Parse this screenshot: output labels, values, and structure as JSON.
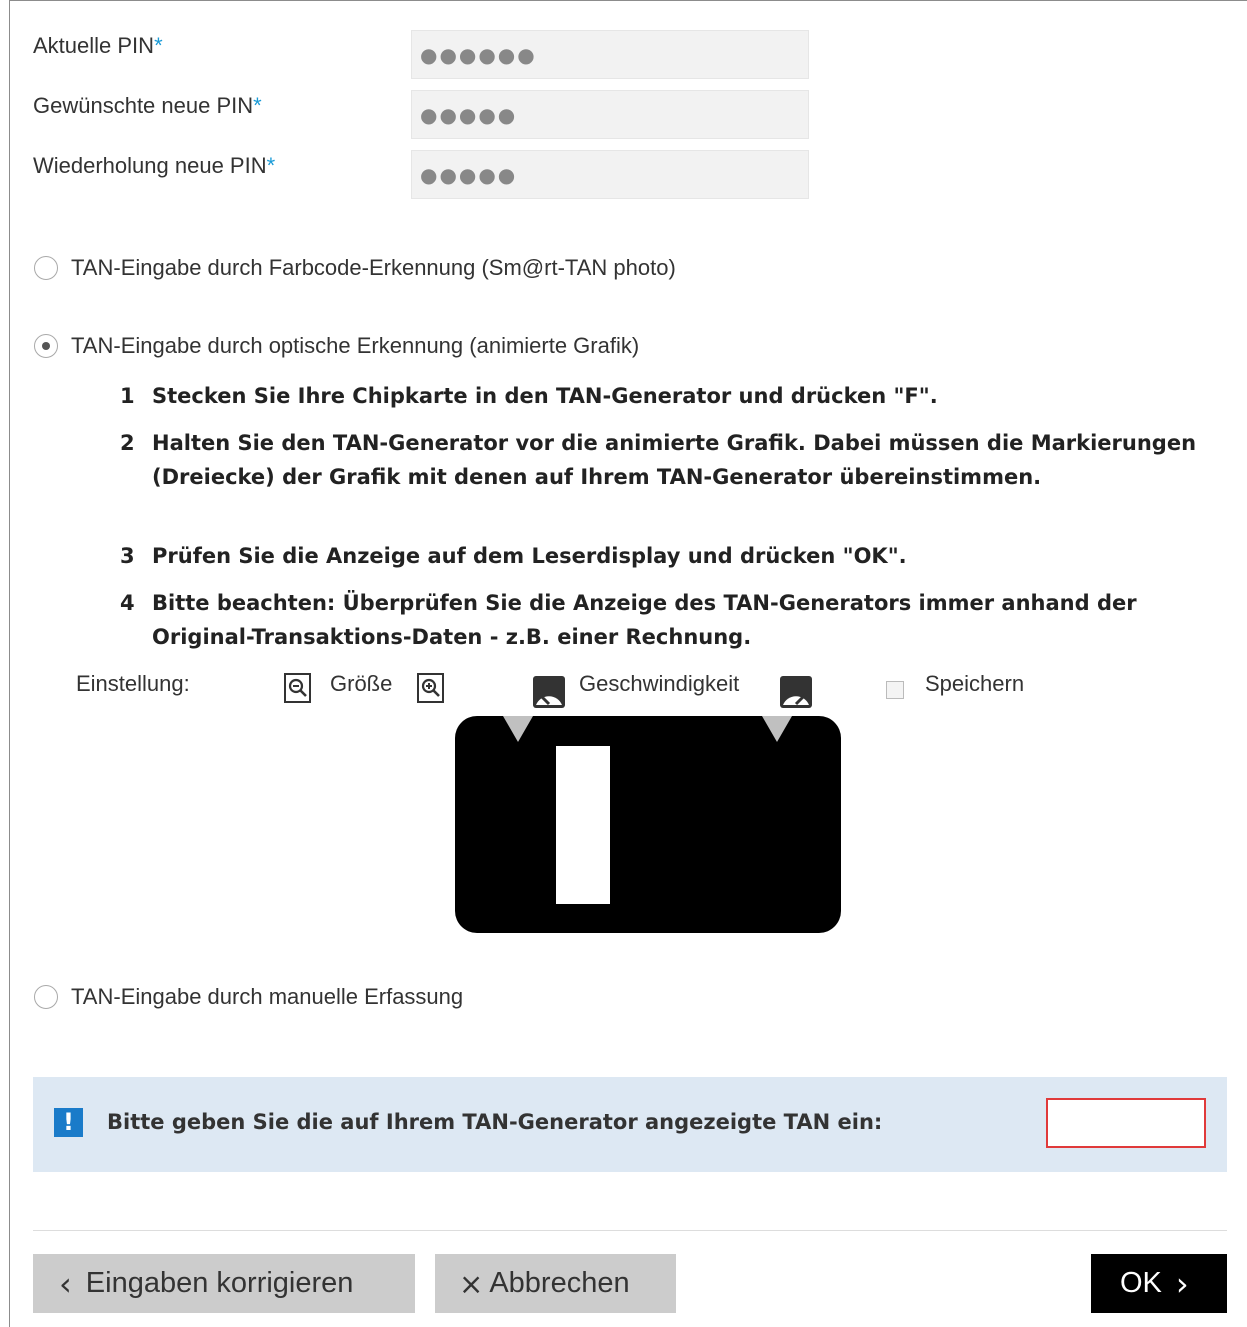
{
  "pin_fields": [
    {
      "label": "Aktuelle PIN",
      "required_mark": "*",
      "value": "●●●●●●"
    },
    {
      "label": "Gewünschte neue PIN",
      "required_mark": "*",
      "value": "●●●●●"
    },
    {
      "label": "Wiederholung neue PIN",
      "required_mark": "*",
      "value": "●●●●●"
    }
  ],
  "tan_methods": [
    {
      "label": "TAN-Eingabe durch Farbcode-Erkennung (Sm@rt-TAN photo)",
      "selected": false
    },
    {
      "label": "TAN-Eingabe durch optische Erkennung (animierte Grafik)",
      "selected": true
    },
    {
      "label": "TAN-Eingabe durch manuelle Erfassung",
      "selected": false
    }
  ],
  "steps": [
    {
      "num": "1",
      "text": "Stecken Sie Ihre Chipkarte in den TAN-Generator und drücken \"F\"."
    },
    {
      "num": "2",
      "text": "Halten Sie den TAN-Generator vor die animierte Grafik. Dabei müssen die Markierungen (Dreiecke) der Grafik mit denen auf Ihrem TAN-Generator übereinstimmen."
    },
    {
      "num": "3",
      "text": "Prüfen Sie die Anzeige auf dem Leserdisplay und drücken \"OK\"."
    },
    {
      "num": "4",
      "text": "Bitte beachten: Überprüfen Sie die Anzeige des TAN-Generators immer anhand der Original-Transaktions-Daten - z.B. einer Rechnung."
    }
  ],
  "settings": {
    "label": "Einstellung:",
    "size_label": "Größe",
    "speed_label": "Geschwindigkeit",
    "save_label": "Speichern",
    "save_checked": false
  },
  "notice": {
    "icon": "!",
    "message": "Bitte geben Sie die auf Ihrem TAN-Generator angezeigte TAN ein:",
    "tan_value": ""
  },
  "buttons": {
    "correct": "Eingaben korrigieren",
    "correct_icon": "‹",
    "cancel": "Abbrechen",
    "cancel_icon": "×",
    "ok": "OK",
    "ok_icon": "›"
  },
  "colors": {
    "accent": "#1a9bd7",
    "notice_bg": "#dde8f3",
    "tan_border": "#e03a3a"
  }
}
